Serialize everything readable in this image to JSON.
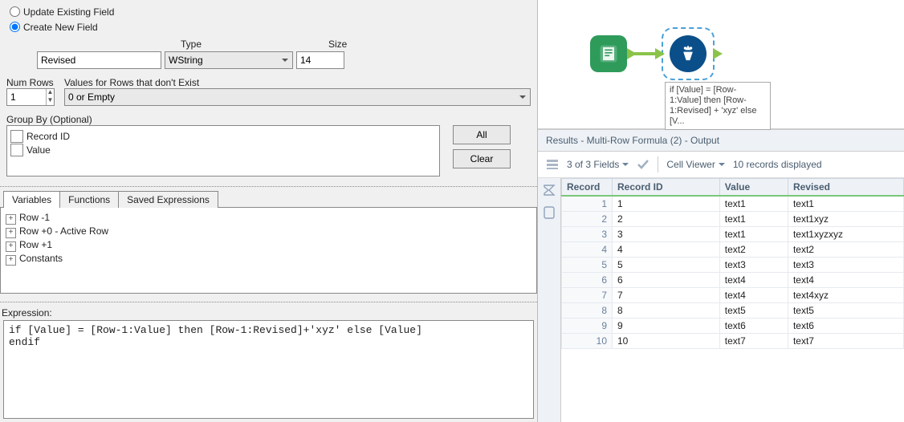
{
  "config": {
    "radio_update_label": "Update Existing Field",
    "radio_create_label": "Create New  Field",
    "field_name_label": "",
    "type_label": "Type",
    "size_label": "Size",
    "field_name_value": "Revised",
    "field_type_value": "WString",
    "field_size_value": "14",
    "num_rows_label": "Num Rows",
    "values_label": "Values for Rows that don't Exist",
    "num_rows_value": "1",
    "values_select_value": "0 or Empty",
    "groupby_label": "Group By (Optional)",
    "groupby_items": [
      "Record ID",
      "Value"
    ],
    "btn_all": "All",
    "btn_clear": "Clear"
  },
  "tabs": {
    "variables": "Variables",
    "functions": "Functions",
    "saved": "Saved Expressions"
  },
  "tree_items": [
    "Row -1",
    "Row +0 - Active Row",
    "Row +1",
    "Constants"
  ],
  "expression_label": "Expression:",
  "expression_value": "if [Value] = [Row-1:Value] then [Row-1:Revised]+'xyz' else [Value]\nendif",
  "canvas": {
    "annotation": "if [Value] = [Row-1:Value] then [Row-1:Revised] + 'xyz' else [V..."
  },
  "results_header": "Results - Multi-Row Formula (2) - Output",
  "toolbar": {
    "fields_text": "3 of 3 Fields",
    "cell_viewer": "Cell Viewer",
    "records_text": "10 records displayed"
  },
  "columns": [
    "Record",
    "Record ID",
    "Value",
    "Revised"
  ],
  "rows": [
    {
      "n": "1",
      "id": "1",
      "value": "text1",
      "revised": "text1"
    },
    {
      "n": "2",
      "id": "2",
      "value": "text1",
      "revised": "text1xyz"
    },
    {
      "n": "3",
      "id": "3",
      "value": "text1",
      "revised": "text1xyzxyz"
    },
    {
      "n": "4",
      "id": "4",
      "value": "text2",
      "revised": "text2"
    },
    {
      "n": "5",
      "id": "5",
      "value": "text3",
      "revised": "text3"
    },
    {
      "n": "6",
      "id": "6",
      "value": "text4",
      "revised": "text4"
    },
    {
      "n": "7",
      "id": "7",
      "value": "text4",
      "revised": "text4xyz"
    },
    {
      "n": "8",
      "id": "8",
      "value": "text5",
      "revised": "text5"
    },
    {
      "n": "9",
      "id": "9",
      "value": "text6",
      "revised": "text6"
    },
    {
      "n": "10",
      "id": "10",
      "value": "text7",
      "revised": "text7"
    }
  ]
}
